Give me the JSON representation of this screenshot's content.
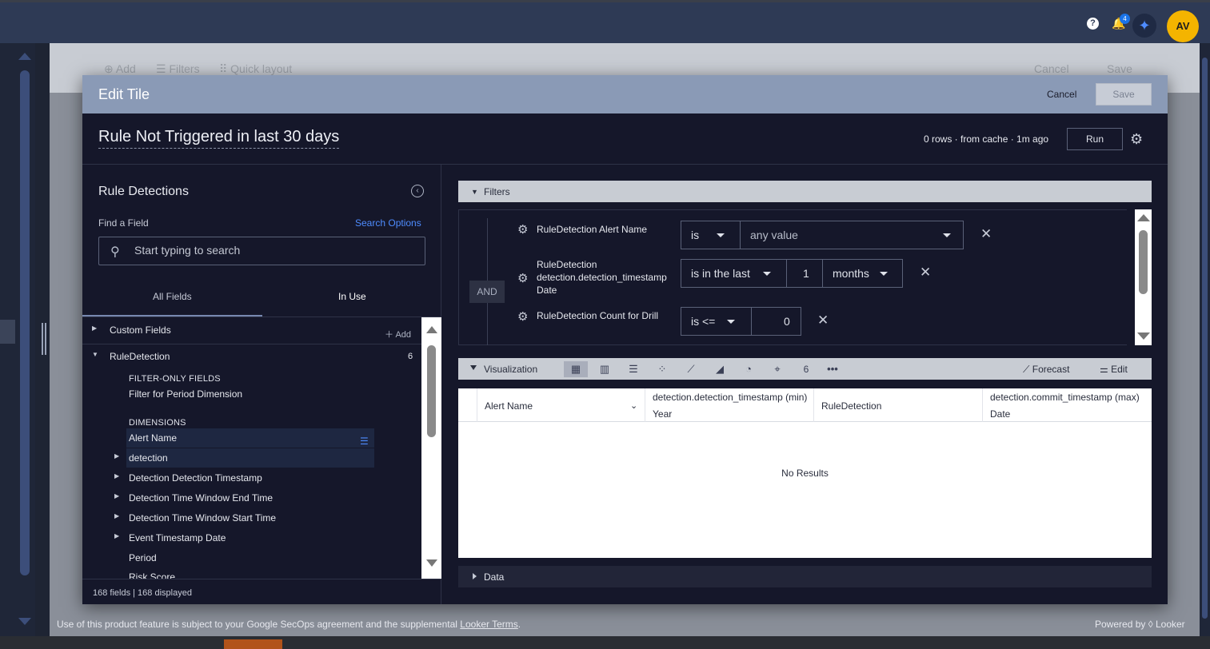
{
  "topbar": {
    "help_glyph": "?",
    "notification_count": "4",
    "avatar_initials": "AV",
    "icons": [
      "help-icon",
      "bell-icon",
      "sparkle-icon"
    ]
  },
  "dashboard_toolbar": {
    "add": "Add",
    "filters": "Filters",
    "quick_layout": "Quick layout",
    "cancel": "Cancel",
    "save": "Save"
  },
  "modal": {
    "title": "Edit Tile",
    "cancel_label": "Cancel",
    "save_label": "Save",
    "tile_title": "Rule Not Triggered in last 30 days",
    "rows_info": "0 rows · from cache · 1m ago",
    "run_label": "Run"
  },
  "picker": {
    "title": "Rule Detections",
    "find_label": "Find a Field",
    "search_options": "Search Options",
    "search_placeholder": "Start typing to search",
    "tabs": [
      "All Fields",
      "In Use"
    ],
    "custom_fields": "Custom Fields",
    "add_label": "Add",
    "group": "RuleDetection",
    "group_count": "6",
    "filter_only_heading": "FILTER-ONLY FIELDS",
    "filter_only": [
      "Filter for Period Dimension"
    ],
    "dimensions_heading": "DIMENSIONS",
    "dimensions": [
      "Alert Name",
      "detection",
      "Detection Detection Timestamp",
      "Detection Time Window End Time",
      "Detection Time Window Start Time",
      "Event Timestamp Date",
      "Period",
      "Risk Score"
    ],
    "footer": "168 fields | 168 displayed"
  },
  "filters": {
    "label": "Filters",
    "and_label": "AND",
    "rows": [
      {
        "name": "RuleDetection Alert Name",
        "operator": "is",
        "value": "any value"
      },
      {
        "name_lines": [
          "RuleDetection",
          "detection.detection_timestamp",
          "Date"
        ],
        "operator": "is in the last",
        "amount": "1",
        "unit": "months"
      },
      {
        "name": "RuleDetection Count for Drill",
        "operator": "is <=",
        "value": "0"
      }
    ]
  },
  "visualization": {
    "label": "Visualization",
    "icons": [
      "table-icon",
      "column-chart-icon",
      "bar-chart-icon",
      "scatter-chart-icon",
      "line-chart-icon",
      "area-chart-icon",
      "pie-chart-icon",
      "map-pin-icon",
      "single-value-icon",
      "more-icon"
    ],
    "single_value_glyph": "6",
    "forecast": "Forecast",
    "edit": "Edit"
  },
  "results": {
    "columns": [
      {
        "line1": "Alert Name"
      },
      {
        "line1": "detection.detection_timestamp (min)",
        "line2": "Year"
      },
      {
        "line1": "RuleDetection"
      },
      {
        "line1": "detection.commit_timestamp (max)",
        "line2": "Date"
      }
    ],
    "empty_text": "No Results"
  },
  "data_section": {
    "label": "Data"
  },
  "footer": {
    "legal_prefix": "Use of this product feature is subject to your Google SecOps agreement and the supplemental ",
    "legal_link": "Looker Terms",
    "legal_suffix": ".",
    "powered_by": "Powered by ◊ Looker"
  }
}
